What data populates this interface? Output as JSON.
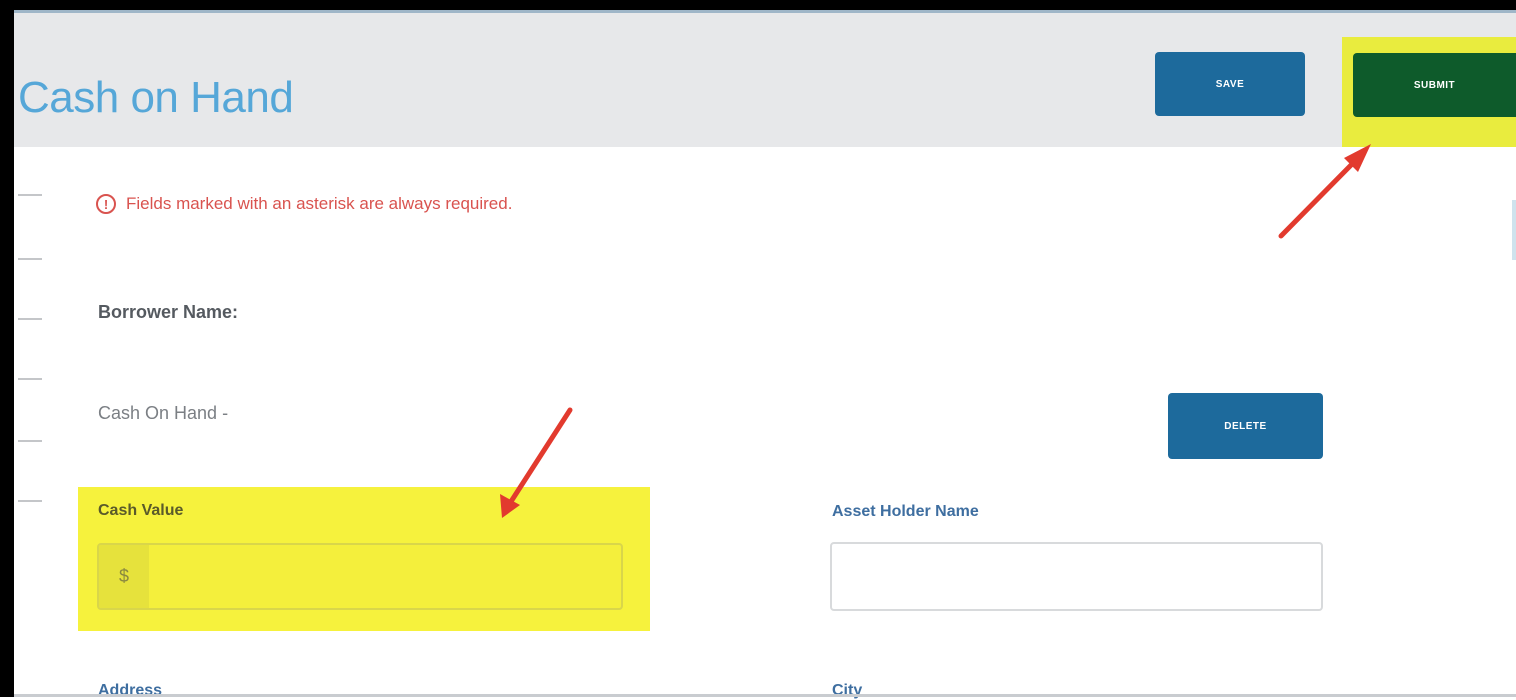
{
  "page_title": "Cash on Hand",
  "toolbar": {
    "save_label": "SAVE",
    "submit_label": "SUBMIT"
  },
  "notice": {
    "icon": "!",
    "text": "Fields marked with an asterisk are always required."
  },
  "borrower": {
    "label": "Borrower Name:"
  },
  "section": {
    "title": "Cash On Hand -",
    "delete_label": "DELETE"
  },
  "form": {
    "cash_value_label": "Cash Value",
    "currency_symbol": "$",
    "cash_value": "",
    "asset_holder_label": "Asset Holder Name",
    "asset_holder_value": "",
    "address_label": "Address",
    "city_label": "City"
  },
  "colors": {
    "title": "#56a7d8",
    "save_button": "#1d6a9c",
    "submit_button": "#0e5b2b",
    "highlight": "#f6f23d",
    "annotation_arrow": "#e23a2e",
    "required_notice": "#d9534f"
  }
}
